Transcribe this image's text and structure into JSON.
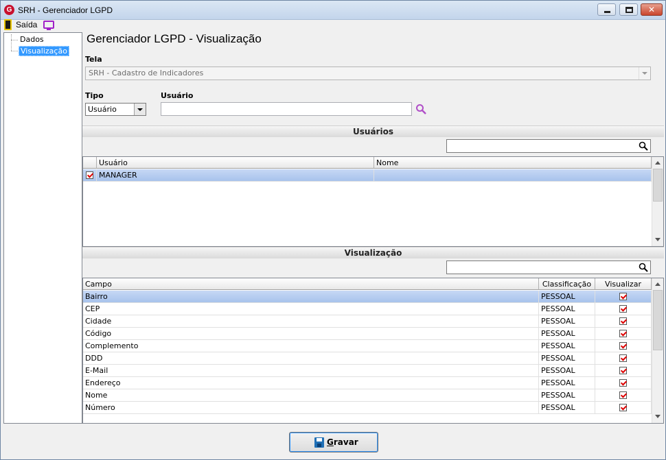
{
  "window": {
    "title": "SRH - Gerenciador LGPD",
    "app_icon": "G"
  },
  "menu": {
    "exit_label": "Saída"
  },
  "tree": {
    "items": [
      {
        "label": "Dados"
      },
      {
        "label": "Visualização"
      }
    ]
  },
  "page": {
    "heading": "Gerenciador LGPD - Visualização"
  },
  "form": {
    "tela_label": "Tela",
    "tela_value": "SRH - Cadastro de Indicadores",
    "tipo_label": "Tipo",
    "tipo_value": "Usuário",
    "usuario_label": "Usuário",
    "usuario_value": ""
  },
  "usuarios_section": {
    "title": "Usuários",
    "filter_value": "",
    "columns": [
      "Usuário",
      "Nome"
    ],
    "rows": [
      {
        "usuario": "MANAGER",
        "nome": "",
        "checked": true
      }
    ]
  },
  "visualizacao_section": {
    "title": "Visualização",
    "filter_value": "",
    "columns": [
      "Campo",
      "Classificação",
      "Visualizar"
    ],
    "rows": [
      {
        "campo": "Bairro",
        "classificacao": "PESSOAL",
        "visualizar": true
      },
      {
        "campo": "CEP",
        "classificacao": "PESSOAL",
        "visualizar": true
      },
      {
        "campo": "Cidade",
        "classificacao": "PESSOAL",
        "visualizar": true
      },
      {
        "campo": "Código",
        "classificacao": "PESSOAL",
        "visualizar": true
      },
      {
        "campo": "Complemento",
        "classificacao": "PESSOAL",
        "visualizar": true
      },
      {
        "campo": "DDD",
        "classificacao": "PESSOAL",
        "visualizar": true
      },
      {
        "campo": "E-Mail",
        "classificacao": "PESSOAL",
        "visualizar": true
      },
      {
        "campo": "Endereço",
        "classificacao": "PESSOAL",
        "visualizar": true
      },
      {
        "campo": "Nome",
        "classificacao": "PESSOAL",
        "visualizar": true
      },
      {
        "campo": "Número",
        "classificacao": "PESSOAL",
        "visualizar": true
      }
    ]
  },
  "footer": {
    "save_label": "Gravar"
  },
  "colors": {
    "selection": "#a8c3ec",
    "accent": "#3399ff",
    "brand": "#c8102e"
  }
}
